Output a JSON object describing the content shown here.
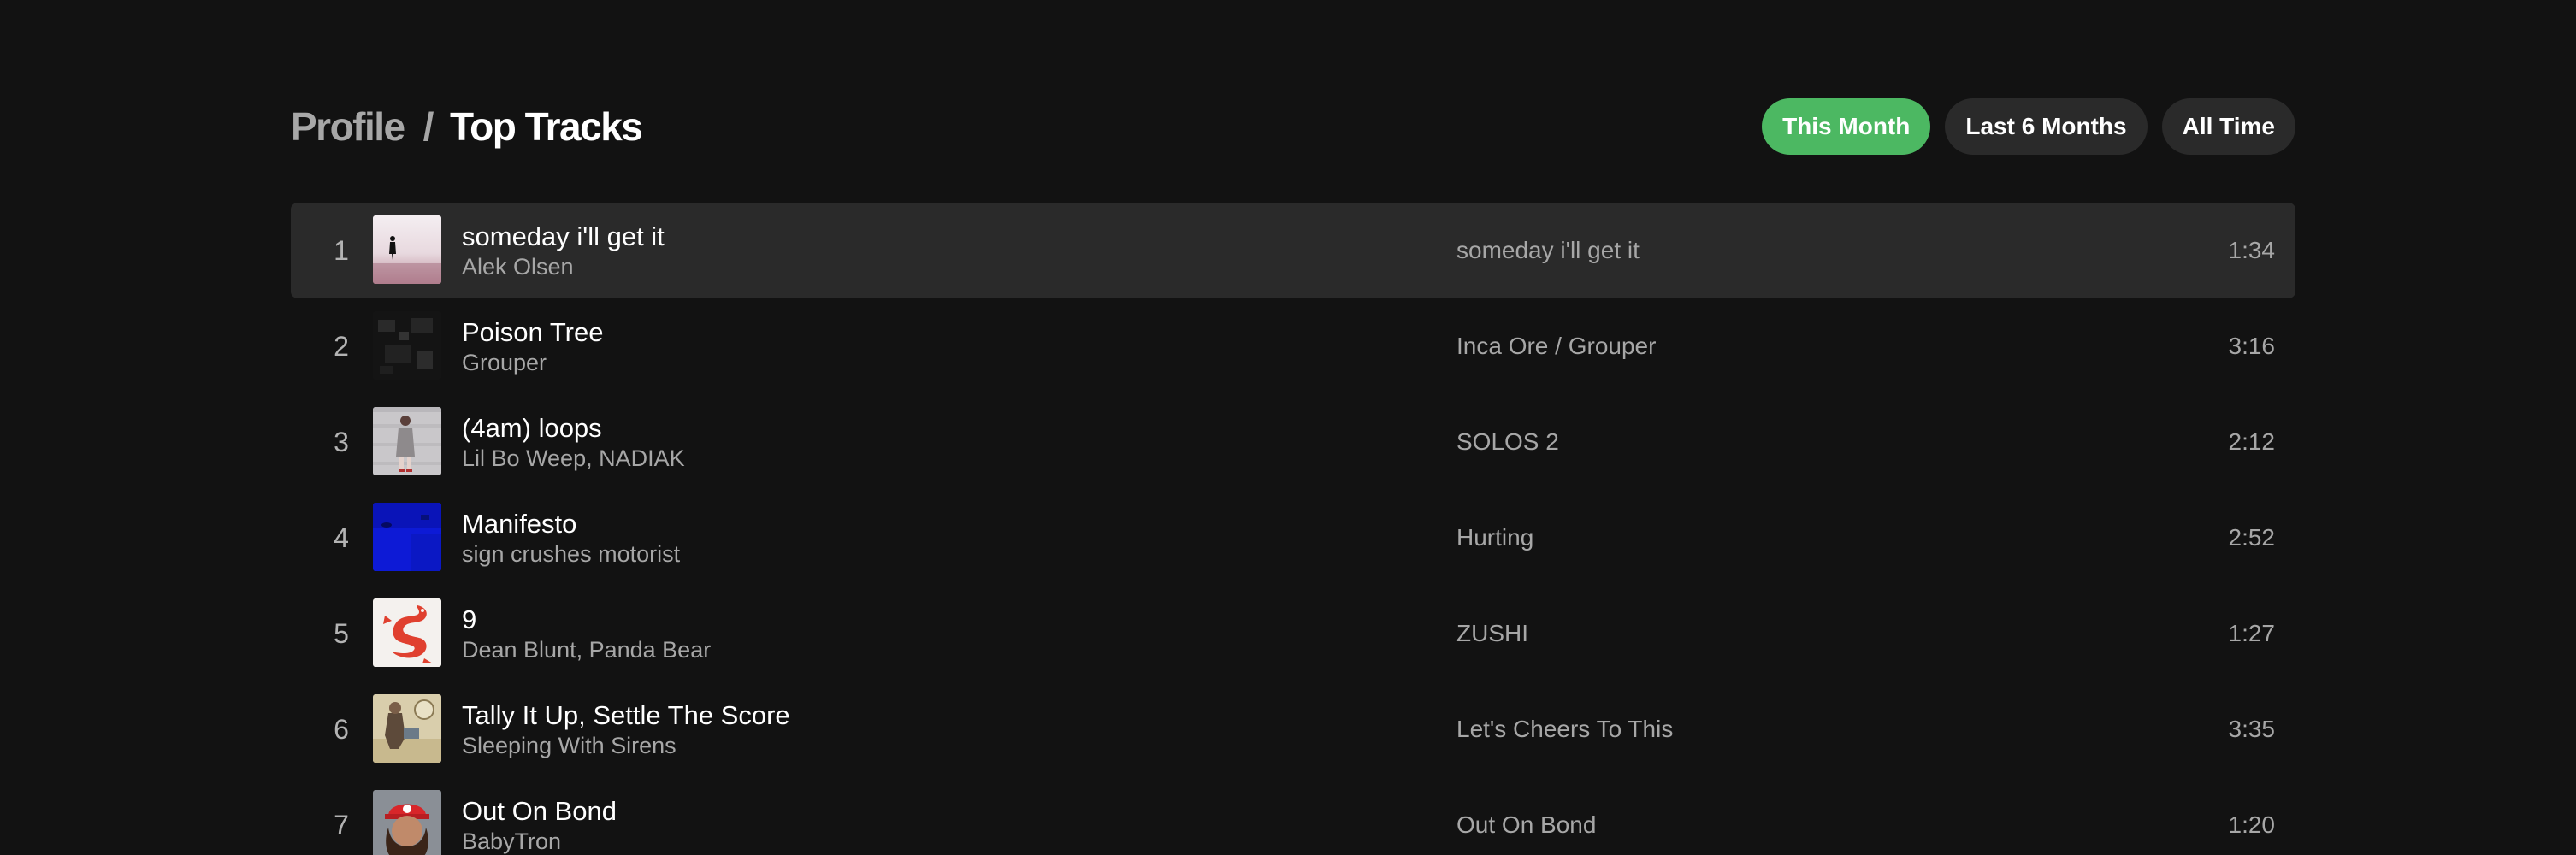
{
  "breadcrumb": {
    "parent": "Profile",
    "separator": "/",
    "current": "Top Tracks"
  },
  "filters": [
    {
      "label": "This Month",
      "active": true
    },
    {
      "label": "Last 6 Months",
      "active": false
    },
    {
      "label": "All Time",
      "active": false
    }
  ],
  "colors": {
    "background": "#121212",
    "highlight_row": "#2a2a2a",
    "accent": "#4cb862",
    "muted_text": "#a7a7a7"
  },
  "tracks": [
    {
      "index": "1",
      "title": "someday i'll get it",
      "artist": "Alek Olsen",
      "album": "someday i'll get it",
      "duration": "1:34",
      "cover_icon": "album-cover-figure-in-mist-icon"
    },
    {
      "index": "2",
      "title": "Poison Tree",
      "artist": "Grouper",
      "album": "Inca Ore / Grouper",
      "duration": "3:16",
      "cover_icon": "album-cover-dark-noise-icon"
    },
    {
      "index": "3",
      "title": "(4am) loops",
      "artist": "Lil Bo Weep, NADIAK",
      "album": "SOLOS 2",
      "duration": "2:12",
      "cover_icon": "album-cover-standing-figure-icon"
    },
    {
      "index": "4",
      "title": "Manifesto",
      "artist": "sign crushes motorist",
      "album": "Hurting",
      "duration": "2:52",
      "cover_icon": "album-cover-blue-icon"
    },
    {
      "index": "5",
      "title": "9",
      "artist": "Dean Blunt, Panda Bear",
      "album": "ZUSHI",
      "duration": "1:27",
      "cover_icon": "album-cover-red-dragon-icon"
    },
    {
      "index": "6",
      "title": "Tally It Up, Settle The Score",
      "artist": "Sleeping With Sirens",
      "album": "Let's Cheers To This",
      "duration": "3:35",
      "cover_icon": "album-cover-vintage-icon"
    },
    {
      "index": "7",
      "title": "Out On Bond",
      "artist": "BabyTron",
      "album": "Out On Bond",
      "duration": "1:20",
      "cover_icon": "album-cover-red-cap-portrait-icon"
    }
  ]
}
